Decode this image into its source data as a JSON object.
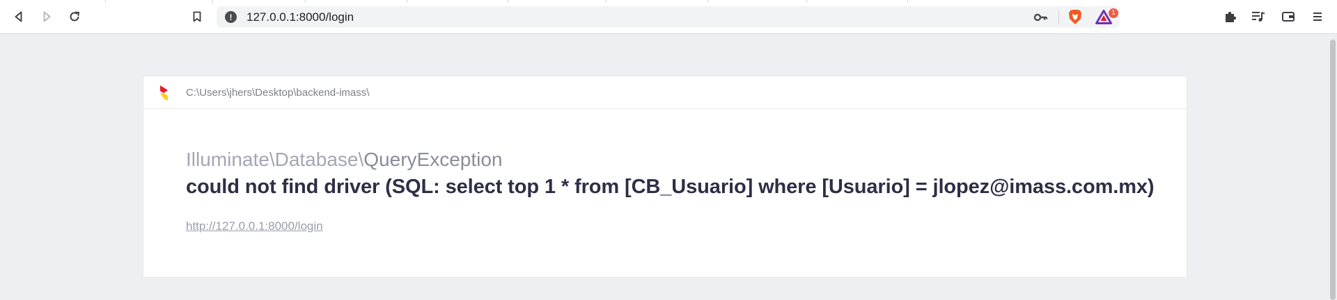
{
  "browser": {
    "url": "127.0.0.1:8000/login",
    "rewards_badge_count": "1",
    "colors": {
      "brave_lion": "#f05a24",
      "rewards": "#6b33b2"
    },
    "icons": {
      "back": "back-arrow-icon",
      "forward": "forward-arrow-icon",
      "reload": "reload-icon",
      "bookmark": "bookmark-icon",
      "site_info": "site-info-icon",
      "password_key": "key-icon",
      "brave_shields": "brave-lion-icon",
      "brave_rewards": "brave-rewards-icon",
      "extensions": "puzzle-icon",
      "media": "playlist-icon",
      "wallet": "wallet-icon",
      "menu": "hamburger-menu-icon"
    }
  },
  "error_page": {
    "project_path": "C:\\Users\\jhers\\Desktop\\backend-imass\\",
    "exception_namespace": "Illuminate\\Database\\",
    "exception_class": "QueryException",
    "exception_message": "could not find driver (SQL: select top 1 * from [CB_Usuario] where [Usuario] = jlopez@imass.com.mx)",
    "request_url": "http://127.0.0.1:8000/login",
    "colors": {
      "logo_red": "#e8192c",
      "logo_yellow": "#ffd01b",
      "message": "#2e2e46",
      "background": "#eeeff3"
    }
  }
}
